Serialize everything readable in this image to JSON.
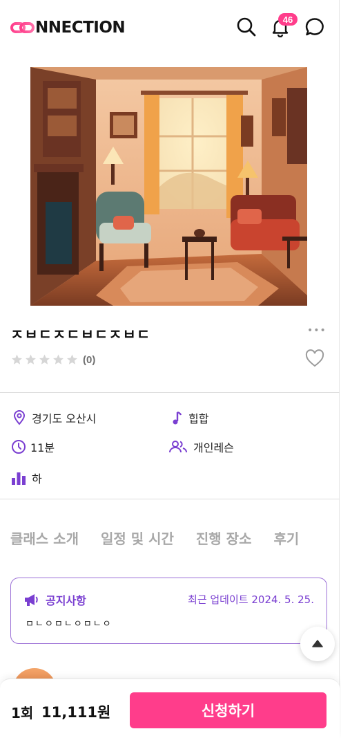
{
  "header": {
    "logo_text": "NNECTION",
    "notification_count": "46",
    "icons": [
      "logo-rings-icon",
      "search-icon",
      "bell-icon",
      "chat-icon"
    ],
    "brand_color": "#ff3d8b"
  },
  "class": {
    "title": "ㅈㅂㄷㅈㄷㅂㄷㅈㅂㄷ",
    "more_label": "•••",
    "rating_count": "(0)",
    "rating_value": 0,
    "rating_max": 5
  },
  "info": {
    "location": "경기도 오산시",
    "genre": "힙합",
    "duration": "11분",
    "lesson_type": "개인레슨",
    "level": "하"
  },
  "tabs": [
    "클래스 소개",
    "일정 및 시간",
    "진행 장소",
    "후기"
  ],
  "notice": {
    "title": "공지사항",
    "updated": "최근 업데이트 2024. 5. 25.",
    "body": "ㅁㄴㅇㅁㄴㅇㅁㄴㅇ"
  },
  "footer": {
    "count": "1회",
    "price": "11,111원",
    "apply_label": "신청하기"
  },
  "colors": {
    "accent_purple": "#7a3fd1",
    "pink": "#ff3d8b"
  }
}
